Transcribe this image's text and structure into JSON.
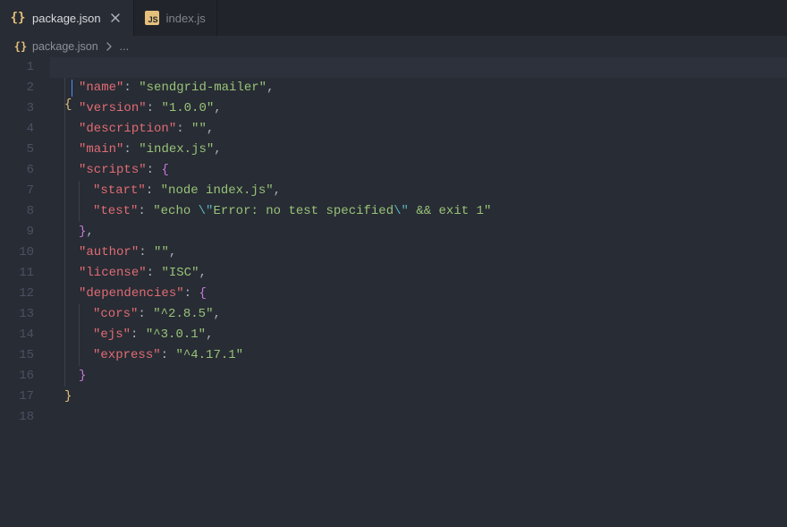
{
  "tabs": [
    {
      "label": "package.json",
      "iconType": "braces",
      "active": true,
      "dirty": false,
      "closable": true
    },
    {
      "label": "index.js",
      "iconType": "js",
      "active": false,
      "dirty": false,
      "closable": false
    }
  ],
  "breadcrumb": {
    "iconType": "braces",
    "file": "package.json",
    "trail": "..."
  },
  "editor": {
    "activeLine": 1,
    "cursor": {
      "line": 1,
      "colPx": 24
    },
    "lineNumbers": [
      "1",
      "2",
      "3",
      "4",
      "5",
      "6",
      "7",
      "8",
      "9",
      "10",
      "11",
      "12",
      "13",
      "14",
      "15",
      "16",
      "17",
      "18"
    ],
    "tokens": [
      [
        {
          "t": "{",
          "c": "br"
        }
      ],
      [
        {
          "t": "  ",
          "c": "p"
        },
        {
          "t": "\"",
          "c": "qk"
        },
        {
          "t": "name",
          "c": "k"
        },
        {
          "t": "\"",
          "c": "qk"
        },
        {
          "t": ": ",
          "c": "c"
        },
        {
          "t": "\"",
          "c": "q"
        },
        {
          "t": "sendgrid-mailer",
          "c": "s"
        },
        {
          "t": "\"",
          "c": "q"
        },
        {
          "t": ",",
          "c": "c"
        }
      ],
      [
        {
          "t": "  ",
          "c": "p"
        },
        {
          "t": "\"",
          "c": "qk"
        },
        {
          "t": "version",
          "c": "k"
        },
        {
          "t": "\"",
          "c": "qk"
        },
        {
          "t": ": ",
          "c": "c"
        },
        {
          "t": "\"",
          "c": "q"
        },
        {
          "t": "1.0.0",
          "c": "s"
        },
        {
          "t": "\"",
          "c": "q"
        },
        {
          "t": ",",
          "c": "c"
        }
      ],
      [
        {
          "t": "  ",
          "c": "p"
        },
        {
          "t": "\"",
          "c": "qk"
        },
        {
          "t": "description",
          "c": "k"
        },
        {
          "t": "\"",
          "c": "qk"
        },
        {
          "t": ": ",
          "c": "c"
        },
        {
          "t": "\"",
          "c": "q"
        },
        {
          "t": "\"",
          "c": "q"
        },
        {
          "t": ",",
          "c": "c"
        }
      ],
      [
        {
          "t": "  ",
          "c": "p"
        },
        {
          "t": "\"",
          "c": "qk"
        },
        {
          "t": "main",
          "c": "k"
        },
        {
          "t": "\"",
          "c": "qk"
        },
        {
          "t": ": ",
          "c": "c"
        },
        {
          "t": "\"",
          "c": "q"
        },
        {
          "t": "index.js",
          "c": "s"
        },
        {
          "t": "\"",
          "c": "q"
        },
        {
          "t": ",",
          "c": "c"
        }
      ],
      [
        {
          "t": "  ",
          "c": "p"
        },
        {
          "t": "\"",
          "c": "qk"
        },
        {
          "t": "scripts",
          "c": "k"
        },
        {
          "t": "\"",
          "c": "qk"
        },
        {
          "t": ": ",
          "c": "c"
        },
        {
          "t": "{",
          "c": "br2"
        }
      ],
      [
        {
          "t": "    ",
          "c": "p"
        },
        {
          "t": "\"",
          "c": "qk"
        },
        {
          "t": "start",
          "c": "k"
        },
        {
          "t": "\"",
          "c": "qk"
        },
        {
          "t": ": ",
          "c": "c"
        },
        {
          "t": "\"",
          "c": "q"
        },
        {
          "t": "node index.js",
          "c": "s"
        },
        {
          "t": "\"",
          "c": "q"
        },
        {
          "t": ",",
          "c": "c"
        }
      ],
      [
        {
          "t": "    ",
          "c": "p"
        },
        {
          "t": "\"",
          "c": "qk"
        },
        {
          "t": "test",
          "c": "k"
        },
        {
          "t": "\"",
          "c": "qk"
        },
        {
          "t": ": ",
          "c": "c"
        },
        {
          "t": "\"",
          "c": "q"
        },
        {
          "t": "echo ",
          "c": "s"
        },
        {
          "t": "\\\"",
          "c": "esc"
        },
        {
          "t": "Error: no test specified",
          "c": "s"
        },
        {
          "t": "\\\"",
          "c": "esc"
        },
        {
          "t": " && exit 1",
          "c": "s"
        },
        {
          "t": "\"",
          "c": "q"
        }
      ],
      [
        {
          "t": "  ",
          "c": "p"
        },
        {
          "t": "}",
          "c": "br2"
        },
        {
          "t": ",",
          "c": "c"
        }
      ],
      [
        {
          "t": "  ",
          "c": "p"
        },
        {
          "t": "\"",
          "c": "qk"
        },
        {
          "t": "author",
          "c": "k"
        },
        {
          "t": "\"",
          "c": "qk"
        },
        {
          "t": ": ",
          "c": "c"
        },
        {
          "t": "\"",
          "c": "q"
        },
        {
          "t": "\"",
          "c": "q"
        },
        {
          "t": ",",
          "c": "c"
        }
      ],
      [
        {
          "t": "  ",
          "c": "p"
        },
        {
          "t": "\"",
          "c": "qk"
        },
        {
          "t": "license",
          "c": "k"
        },
        {
          "t": "\"",
          "c": "qk"
        },
        {
          "t": ": ",
          "c": "c"
        },
        {
          "t": "\"",
          "c": "q"
        },
        {
          "t": "ISC",
          "c": "s"
        },
        {
          "t": "\"",
          "c": "q"
        },
        {
          "t": ",",
          "c": "c"
        }
      ],
      [
        {
          "t": "  ",
          "c": "p"
        },
        {
          "t": "\"",
          "c": "qk"
        },
        {
          "t": "dependencies",
          "c": "k"
        },
        {
          "t": "\"",
          "c": "qk"
        },
        {
          "t": ": ",
          "c": "c"
        },
        {
          "t": "{",
          "c": "br2"
        }
      ],
      [
        {
          "t": "    ",
          "c": "p"
        },
        {
          "t": "\"",
          "c": "qk"
        },
        {
          "t": "cors",
          "c": "k"
        },
        {
          "t": "\"",
          "c": "qk"
        },
        {
          "t": ": ",
          "c": "c"
        },
        {
          "t": "\"",
          "c": "q"
        },
        {
          "t": "^2.8.5",
          "c": "s"
        },
        {
          "t": "\"",
          "c": "q"
        },
        {
          "t": ",",
          "c": "c"
        }
      ],
      [
        {
          "t": "    ",
          "c": "p"
        },
        {
          "t": "\"",
          "c": "qk"
        },
        {
          "t": "ejs",
          "c": "k"
        },
        {
          "t": "\"",
          "c": "qk"
        },
        {
          "t": ": ",
          "c": "c"
        },
        {
          "t": "\"",
          "c": "q"
        },
        {
          "t": "^3.0.1",
          "c": "s"
        },
        {
          "t": "\"",
          "c": "q"
        },
        {
          "t": ",",
          "c": "c"
        }
      ],
      [
        {
          "t": "    ",
          "c": "p"
        },
        {
          "t": "\"",
          "c": "qk"
        },
        {
          "t": "express",
          "c": "k"
        },
        {
          "t": "\"",
          "c": "qk"
        },
        {
          "t": ": ",
          "c": "c"
        },
        {
          "t": "\"",
          "c": "q"
        },
        {
          "t": "^4.17.1",
          "c": "s"
        },
        {
          "t": "\"",
          "c": "q"
        }
      ],
      [
        {
          "t": "  ",
          "c": "p"
        },
        {
          "t": "}",
          "c": "br2"
        }
      ],
      [
        {
          "t": "}",
          "c": "br"
        }
      ],
      []
    ]
  }
}
